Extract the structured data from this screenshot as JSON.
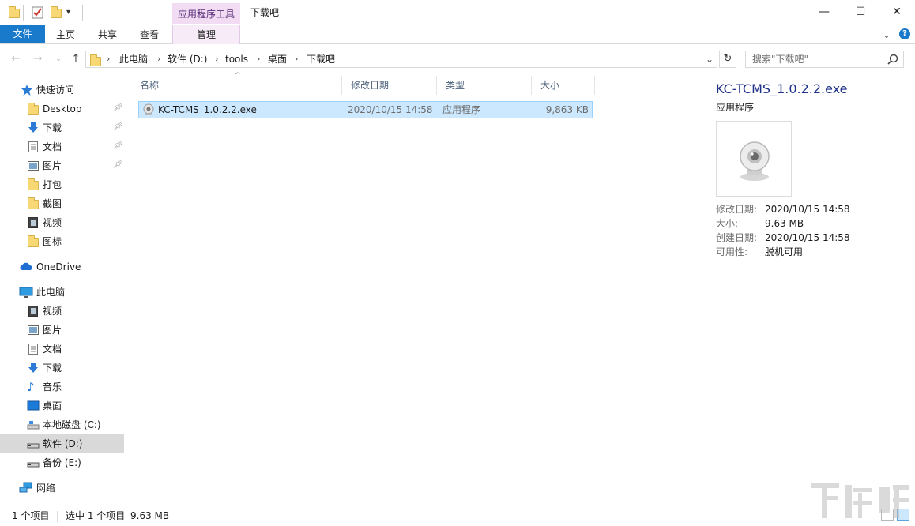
{
  "titlebar": {
    "title": "下载吧",
    "context_tab_header": "应用程序工具",
    "minimize_glyph": "—",
    "maximize_glyph": "☐",
    "close_glyph": "✕"
  },
  "ribbon": {
    "tabs": [
      "文件",
      "主页",
      "共享",
      "查看",
      "管理"
    ],
    "chevron_glyph": "⌄",
    "help_glyph": "?"
  },
  "address": {
    "crumbs": [
      "此电脑",
      "软件 (D:)",
      "tools",
      "桌面",
      "下载吧"
    ],
    "dropdown_glyph": "⌄",
    "refresh_glyph": "↻"
  },
  "search": {
    "placeholder": "搜索\"下载吧\""
  },
  "nav": {
    "quick_access": "快速访问",
    "quick_items": [
      {
        "label": "Desktop",
        "icon": "folder-icon",
        "pinned": true
      },
      {
        "label": "下载",
        "icon": "download-icon",
        "pinned": true
      },
      {
        "label": "文档",
        "icon": "document-icon",
        "pinned": true
      },
      {
        "label": "图片",
        "icon": "picture-icon",
        "pinned": true
      },
      {
        "label": "打包",
        "icon": "folder-icon",
        "pinned": false
      },
      {
        "label": "截图",
        "icon": "folder-icon",
        "pinned": false
      },
      {
        "label": "视频",
        "icon": "video-icon",
        "pinned": false
      },
      {
        "label": "图标",
        "icon": "folder-icon",
        "pinned": false
      }
    ],
    "onedrive": "OneDrive",
    "this_pc": "此电脑",
    "pc_items": [
      {
        "label": "视频",
        "icon": "video-icon"
      },
      {
        "label": "图片",
        "icon": "picture-icon"
      },
      {
        "label": "文档",
        "icon": "document-icon"
      },
      {
        "label": "下载",
        "icon": "download-icon"
      },
      {
        "label": "音乐",
        "icon": "music-icon"
      },
      {
        "label": "桌面",
        "icon": "desktop-icon"
      },
      {
        "label": "本地磁盘 (C:)",
        "icon": "drive-icon"
      },
      {
        "label": "软件 (D:)",
        "icon": "drive-icon",
        "selected": true
      },
      {
        "label": "备份 (E:)",
        "icon": "drive-icon"
      }
    ],
    "network": "网络"
  },
  "file_list": {
    "columns": [
      "名称",
      "修改日期",
      "类型",
      "大小"
    ],
    "sort_glyph": "^",
    "rows": [
      {
        "name": "KC-TCMS_1.0.2.2.exe",
        "modified": "2020/10/15 14:58",
        "type": "应用程序",
        "size": "9,863 KB"
      }
    ]
  },
  "details": {
    "name": "KC-TCMS_1.0.2.2.exe",
    "type": "应用程序",
    "props": [
      {
        "key": "修改日期:",
        "value": "2020/10/15 14:58"
      },
      {
        "key": "大小:",
        "value": "9.63 MB"
      },
      {
        "key": "创建日期:",
        "value": "2020/10/15 14:58"
      },
      {
        "key": "可用性:",
        "value": "脱机可用"
      }
    ]
  },
  "status": {
    "item_count": "1 个项目",
    "selected": "选中 1 个项目",
    "selected_size": "9.63 MB"
  },
  "colors": {
    "accent": "#1979ca",
    "context_tab": "#f1dcf4",
    "selection": "#cce8ff",
    "details_title": "#1e3287"
  }
}
